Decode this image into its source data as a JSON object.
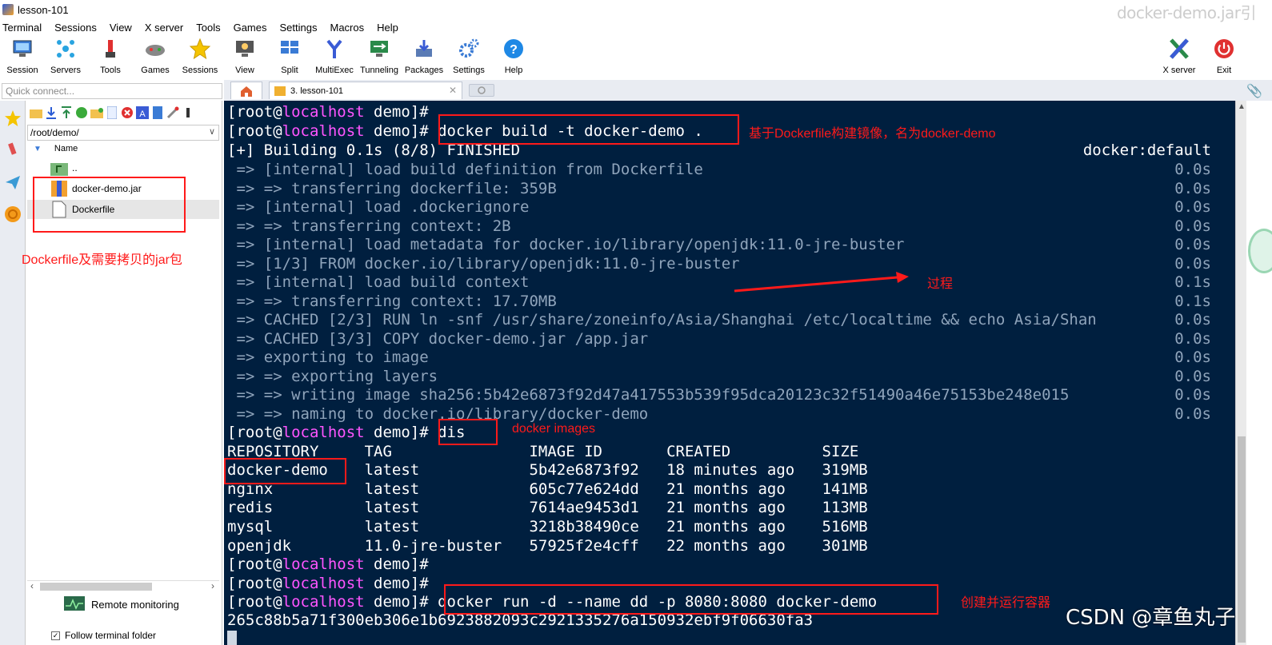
{
  "window": {
    "title": "lesson-101",
    "watermark": "docker-demo.jar引"
  },
  "menu": [
    "Terminal",
    "Sessions",
    "View",
    "X server",
    "Tools",
    "Games",
    "Settings",
    "Macros",
    "Help"
  ],
  "toolbar": {
    "session": "Session",
    "servers": "Servers",
    "tools": "Tools",
    "games": "Games",
    "sessions": "Sessions",
    "view": "View",
    "split": "Split",
    "multiexec": "MultiExec",
    "tunneling": "Tunneling",
    "packages": "Packages",
    "settings": "Settings",
    "help": "Help",
    "xserver": "X server",
    "exit": "Exit"
  },
  "quick_connect": {
    "placeholder": "Quick connect..."
  },
  "tabs": {
    "active_label": "3. lesson-101",
    "close": "✕"
  },
  "files": {
    "path": "/root/demo/",
    "column": "Name",
    "items": [
      "..",
      "docker-demo.jar",
      "Dockerfile"
    ],
    "remote_monitoring": "Remote monitoring",
    "follow_folder": "Follow terminal folder"
  },
  "terminal": {
    "user": "[root@",
    "host": "localhost",
    "dir": " demo]# ",
    "cmd_build": "docker build -t docker-demo .",
    "building": "[+] Building 0.1s (8/8) FINISHED",
    "building_right": "docker:default",
    "steps": [
      {
        "text": " => [internal] load build definition from Dockerfile",
        "time": "0.0s"
      },
      {
        "text": " => => transferring dockerfile: 359B",
        "time": "0.0s"
      },
      {
        "text": " => [internal] load .dockerignore",
        "time": "0.0s"
      },
      {
        "text": " => => transferring context: 2B",
        "time": "0.0s"
      },
      {
        "text": " => [internal] load metadata for docker.io/library/openjdk:11.0-jre-buster",
        "time": "0.0s"
      },
      {
        "text": " => [1/3] FROM docker.io/library/openjdk:11.0-jre-buster",
        "time": "0.0s"
      },
      {
        "text": " => [internal] load build context",
        "time": "0.1s"
      },
      {
        "text": " => => transferring context: 17.70MB",
        "time": "0.1s"
      },
      {
        "text": " => CACHED [2/3] RUN ln -snf /usr/share/zoneinfo/Asia/Shanghai /etc/localtime && echo Asia/Shan",
        "time": "0.0s"
      },
      {
        "text": " => CACHED [3/3] COPY docker-demo.jar /app.jar",
        "time": "0.0s"
      },
      {
        "text": " => exporting to image",
        "time": "0.0s"
      },
      {
        "text": " => => exporting layers",
        "time": "0.0s"
      },
      {
        "text": " => => writing image sha256:5b42e6873f92d47a417553b539f95dca20123c32f51490a46e75153be248e015",
        "time": "0.0s"
      },
      {
        "text": " => => naming to docker.io/library/docker-demo",
        "time": "0.0s"
      }
    ],
    "cmd_dis": "dis",
    "images_header": "REPOSITORY     TAG               IMAGE ID       CREATED          SIZE",
    "images": [
      "docker-demo    latest            5b42e6873f92   18 minutes ago   319MB",
      "nginx          latest            605c77e624dd   21 months ago    141MB",
      "redis          latest            7614ae9453d1   21 months ago    113MB",
      "mysql          latest            3218b38490ce   21 months ago    516MB",
      "openjdk        11.0-jre-buster   57925f2e4cff   22 months ago    301MB"
    ],
    "cmd_run": "docker run -d --name dd -p 8080:8080 docker-demo",
    "container_id": "265c88b5a71f300eb306e1b6923882093c2921335276a150932ebf9f06630fa3"
  },
  "annotations": {
    "build": "基于Dockerfile构建镜像，名为docker-demo",
    "files": "Dockerfile及需要拷贝的jar包",
    "process": "过程",
    "images": "docker images",
    "run": "创建并运行容器"
  },
  "watermark_csdn": "CSDN @章鱼丸子",
  "colors": {
    "terminal_bg": "#001f3f",
    "host": "#ff55ff",
    "annotation": "#ff1a1a"
  }
}
